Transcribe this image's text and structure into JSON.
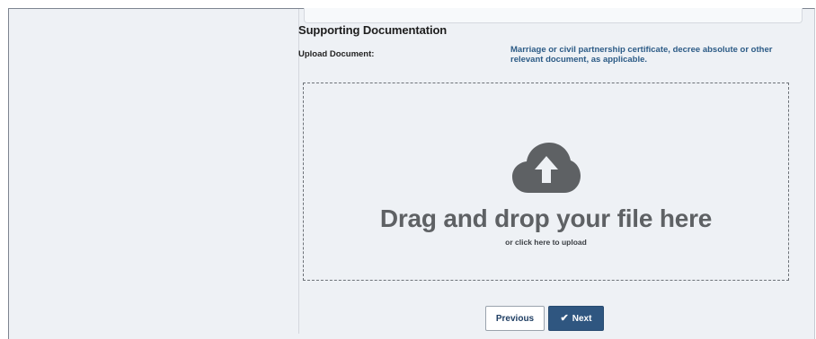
{
  "section": {
    "title": "Supporting Documentation",
    "upload_label": "Upload Document:",
    "hint": "Marriage or civil partnership certificate, decree absolute or other relevant document, as applicable."
  },
  "dropzone": {
    "icon": "cloud-upload-icon",
    "title": "Drag and drop your file here",
    "subtitle": "or click here to upload"
  },
  "buttons": {
    "previous_label": "Previous",
    "next_label": "Next",
    "next_icon": "check-icon"
  },
  "colors": {
    "panel_bg": "#eef1f5",
    "hint_text": "#2c5b86",
    "primary_button": "#2f5680",
    "cloud_icon": "#5e6164"
  }
}
